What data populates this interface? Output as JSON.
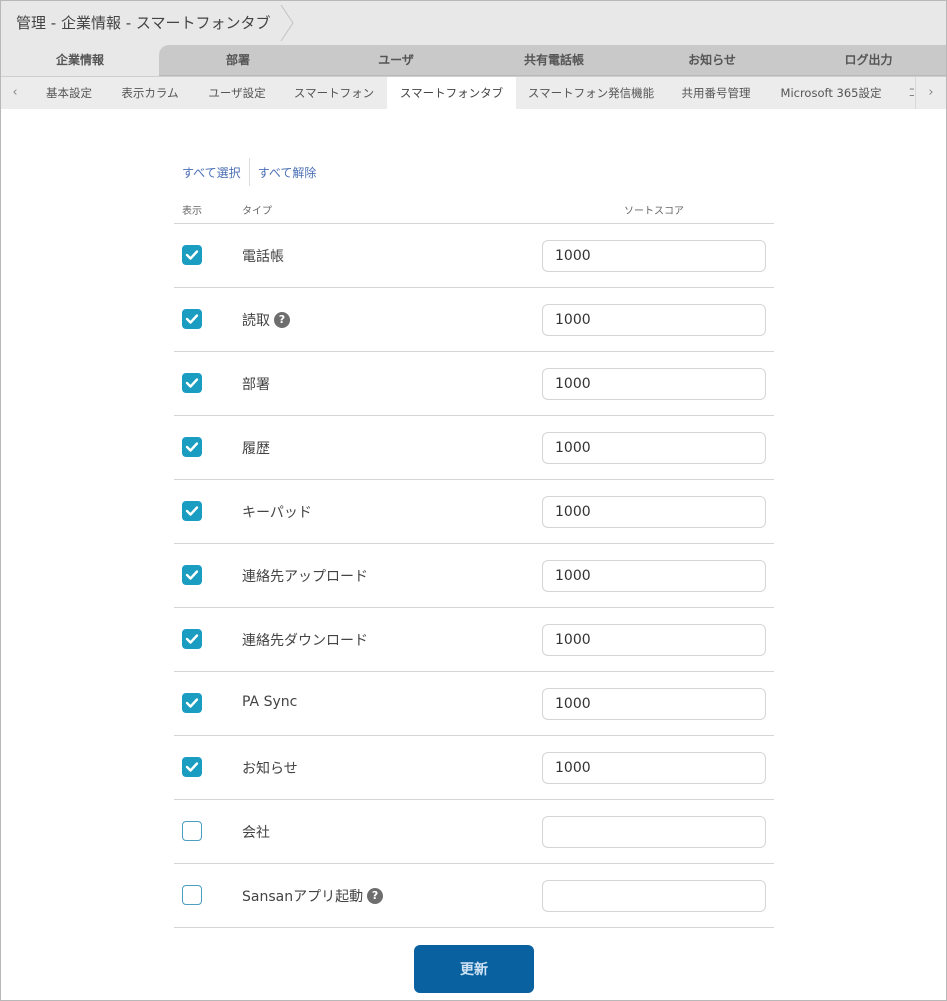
{
  "breadcrumb": "管理 - 企業情報 - スマートフォンタブ",
  "main_tabs": [
    {
      "label": "企業情報",
      "active": true
    },
    {
      "label": "部署",
      "active": false
    },
    {
      "label": "ユーザ",
      "active": false
    },
    {
      "label": "共有電話帳",
      "active": false
    },
    {
      "label": "お知らせ",
      "active": false
    },
    {
      "label": "ログ出力",
      "active": false
    }
  ],
  "sub_tabs": [
    {
      "label": "基本設定",
      "active": false
    },
    {
      "label": "表示カラム",
      "active": false
    },
    {
      "label": "ユーザ設定",
      "active": false
    },
    {
      "label": "スマートフォン",
      "active": false
    },
    {
      "label": "スマートフォンタブ",
      "active": true
    },
    {
      "label": "スマートフォン発信機能",
      "active": false
    },
    {
      "label": "共用番号管理",
      "active": false
    },
    {
      "label": "Microsoft 365設定",
      "active": false
    }
  ],
  "sub_tab_overflow": "コ",
  "sub_nav": {
    "prev_icon": "‹",
    "next_icon": "›"
  },
  "bulk": {
    "select_all": "すべて選択",
    "deselect_all": "すべて解除"
  },
  "table": {
    "headers": {
      "show": "表示",
      "type": "タイプ",
      "score": "ソートスコア"
    },
    "rows": [
      {
        "type": "電話帳",
        "checked": true,
        "help": false,
        "score": "1000"
      },
      {
        "type": "読取",
        "checked": true,
        "help": true,
        "score": "1000"
      },
      {
        "type": "部署",
        "checked": true,
        "help": false,
        "score": "1000"
      },
      {
        "type": "履歴",
        "checked": true,
        "help": false,
        "score": "1000"
      },
      {
        "type": "キーパッド",
        "checked": true,
        "help": false,
        "score": "1000"
      },
      {
        "type": "連絡先アップロード",
        "checked": true,
        "help": false,
        "score": "1000"
      },
      {
        "type": "連絡先ダウンロード",
        "checked": true,
        "help": false,
        "score": "1000"
      },
      {
        "type": "PA Sync",
        "checked": true,
        "help": false,
        "score": "1000"
      },
      {
        "type": "お知らせ",
        "checked": true,
        "help": false,
        "score": "1000"
      },
      {
        "type": "会社",
        "checked": false,
        "help": false,
        "score": ""
      },
      {
        "type": "Sansanアプリ起動",
        "checked": false,
        "help": true,
        "score": ""
      }
    ]
  },
  "help_glyph": "?",
  "update_button": "更新",
  "colors": {
    "checkbox_on": "#1a9dc1",
    "primary_button": "#0a61a0",
    "link": "#4a6fb5"
  }
}
